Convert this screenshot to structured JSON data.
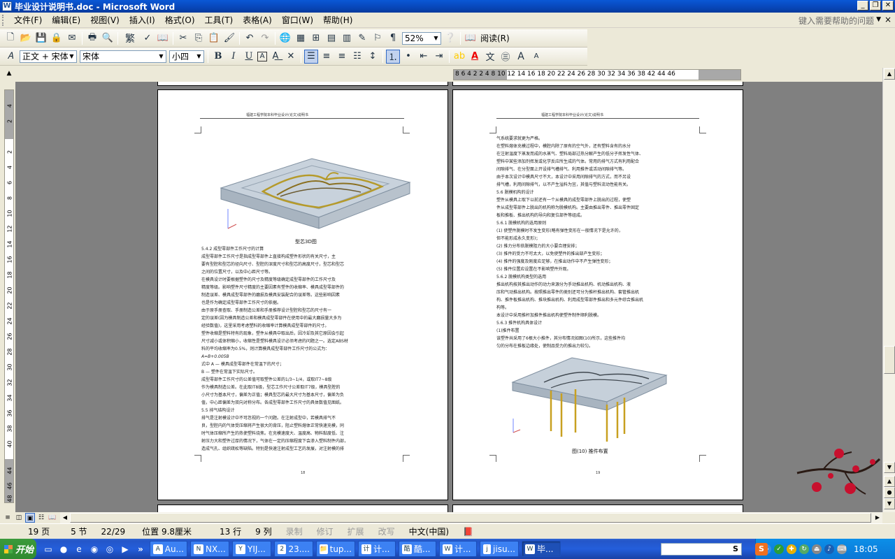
{
  "window": {
    "title": "毕业设计说明书.doc - Microsoft Word",
    "app_icon": "W",
    "min": "_",
    "max": "❐",
    "close": "✕"
  },
  "menu": {
    "items": [
      "文件(F)",
      "编辑(E)",
      "视图(V)",
      "插入(I)",
      "格式(O)",
      "工具(T)",
      "表格(A)",
      "窗口(W)",
      "帮助(H)"
    ],
    "help_placeholder": "键入需要帮助的问题",
    "close": "×"
  },
  "toolbar_standard": {
    "trad_simpl": "繁",
    "zoom": "52%",
    "read_mode": "阅读(R)"
  },
  "toolbar_format": {
    "style": "正文 + 宋体",
    "font": "宋体",
    "size": "小四",
    "bold": "B",
    "italic": "I",
    "underline": "U",
    "char_border": "A",
    "font_color": "A",
    "grow": "A",
    "shrink": "A"
  },
  "ruler": {
    "h_numbers": "8  6  4  2     2   4     8  10  12  14  16  18  20  22  24  26  28  30  32  34  36  38     42  44  46",
    "v_numbers": [
      "4",
      "2",
      "2",
      "4",
      "6",
      "8",
      "10",
      "12",
      "14",
      "16",
      "18",
      "20",
      "22",
      "24",
      "26",
      "28",
      "30",
      "32",
      "34",
      "36",
      "38",
      "40",
      "44",
      "46",
      "48"
    ]
  },
  "document": {
    "header_text": "福建工程学院本科毕业设计(论文)说明书",
    "left_page": {
      "caption": "型芯3D图",
      "page_number": "18",
      "lines": [
        "5.4.2  成型零部件工作尺寸的计算",
        "    成型零部件工作尺寸是指成型零部件上直接构成塑件形状的有关尺寸，主",
        "要有型腔和型芯的径向尺寸、型腔的深度尺寸和型芯的高度尺寸，型芯和型芯",
        "之间的位置尺寸，以及中心距尺寸等。",
        "    在模具设计时要根据塑件的尺寸及精度等级确定成型零部件的工作尺寸及",
        "精度等级。影响塑件尺寸精度的主要因素有塑件的收缩率、模具成型零部件的",
        "制造误差、模具成型零部件的磨损及模具安装配合的误差等。这些影响因素",
        "也是作为确定成型零部件工作尺寸的依据。",
        "    由于原手册查取、手册制造公差和手册推荐设计型腔和型芯的尺寸有一",
        "定的误差(因为模具制造公差和模具成型零部件在使用中的最大磨损量大多为",
        "经验数值)，这里采用考虑塑料的收缩率计算模具成型零部件的尺寸。",
        "    塑件收缩是塑料特有的现象，塑件从模具中取出后，因冷却及其它原因会引起",
        "尺寸减小或体积缩小，收缩性是塑料模具设计必须考虑的问题之一。选定ABS材",
        "料的平均收缩率为0.5%，则计算模具成型零部件工作尺寸的公式为：",
        "                          A=B+0.005B",
        "    式中         A — 模具成型零部件在常温下的尺寸；",
        "                 B — 塑件在常温下实际尺寸。",
        "    成型零部件工作尺寸的公差值可取塑件公差的1/3~1/4，或取IT7~8级",
        "作为模具制造公差。在此取IT8级，型芯工作尺寸公差取IT7级，模具型腔的",
        "小尺寸为基本尺寸，偏差为正值；模具型芯的最大尺寸为基本尺寸，偏差为负",
        "值，中心距偏差为双向对称分布。各成型零部件工作尺寸的具体数值见图纸。",
        "5.5  排气结构设计",
        "    排气是注射模设计中不可忽视的一个问题。在注射成型中，若模具排气不",
        "良，型腔内的气体受压缩将产生很大的背压，阻止塑料熔体正常快速充模，同",
        "时气体压缩所产生的热使塑料烧焦。在充模速度大、温度高、物料黏度低、注",
        "射压力大和塑件过厚的情况下，气体在一定的压缩程度下会渗入塑料制件内部，",
        "造成气孔、组织疏松等缺陷。特别是快速注射成型工艺的发展，对注射模的排"
      ]
    },
    "right_page": {
      "caption": "图(10) 推件布置",
      "page_number": "19",
      "lines": [
        "气系统要求就更为严格。",
        "    在塑料熔体充模过程中，模腔内除了原有的空气外，还有塑料含有的水分",
        "在注射温度下蒸发而成的水蒸气、塑料局部过热分解产生的低分子挥发性气体、",
        "塑料中某些添加剂挥发或化学反应所生成的气体。常用的排气方式有利用配合",
        "间隙排气、在分型面上开设排气槽排气、利用推件或活动间隙排气等。",
        "    由于本次设计中模具尺寸不大，本设计中采用间隙排气的方式，而不另设",
        "排气槽，利用间隙排气，以不产生溢料为宜，其值与塑料流动性能有关。",
        "5.6  脱模机构的设计",
        "    塑件从模具上取下以前还有一个从模具的成型零部件上脱出的过程，使塑",
        "件从成型零部件上脱出的机构称为脱模机构。主要由推出零件、推出零件固定",
        "板和推板、推出机构的导向和复位部件等组成。",
        "5.6.1  脱模机构的选用原则",
        "    (1)  使塑件脱模时不发生变形(略有弹性变形在一般情况下是允许的，",
        "         但不能形成永久变形)；",
        "    (2)  推力分布依脱模阻力的大小要合理安排；",
        "    (3)  推件的受力不可太大，以免使塑件的推出部产生变形；",
        "    (4)  推件的强度及刚度应足够，在推出动作中不产生弹性变形；",
        "    (5)  推件位置应设置在不影响塑件外观。",
        "5.6.2  脱模机构类型的选用",
        "    推出机构按其推出动作的动力来源分为手动推出机构、机动推出机构、液",
        "压和气动推出机构。按照推出零件的类别还可分为推杆推出机构、套管推出机",
        "构、推件板推出机构、推块推出机构、利用成型零部件推出和多元件综合推出机",
        "构等。",
        "    本设计中采用推杆加推件推出机构使塑件制件顺利脱模。",
        "5.6.3  推件机构具体设计",
        "(1)推件布置",
        "    该塑件共采用了6根大小推件，其分布情况如图(10)所示，这些推件均",
        "匀的分布在推板边缘处，使制品受力的推出力较匀。"
      ]
    }
  },
  "status": {
    "page": "19 页",
    "section": "5 节",
    "pages": "22/29",
    "position": "位置 9.8厘米",
    "line": "13 行",
    "column": "9 列",
    "rec": "录制",
    "trk": "修订",
    "ext": "扩展",
    "ovr": "改写",
    "language": "中文(中国)"
  },
  "taskbar": {
    "start": "开始",
    "more": "»",
    "tasks": [
      {
        "label": "Au...",
        "icon": "A"
      },
      {
        "label": "NX...",
        "icon": "N"
      },
      {
        "label": "YIJ...",
        "icon": "Y"
      },
      {
        "label": "23....",
        "icon": "2"
      },
      {
        "label": "tup...",
        "icon": "📁"
      },
      {
        "label": "计...",
        "icon": "计"
      },
      {
        "label": "酷...",
        "icon": "酷"
      },
      {
        "label": "计...",
        "icon": "W"
      },
      {
        "label": "jisu...",
        "icon": "j"
      },
      {
        "label": "毕...",
        "icon": "W"
      }
    ],
    "search_btn": "S",
    "sogou": "S",
    "clock": "18:05"
  },
  "colors": {
    "titlebar": "#0846b8",
    "taskbar": "#245edb",
    "start": "#2f8a2f",
    "workspace": "#808080"
  }
}
